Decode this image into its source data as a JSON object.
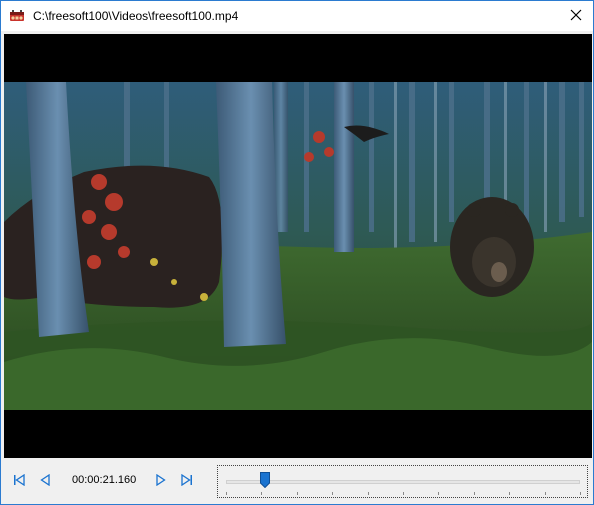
{
  "window": {
    "title": "C:\\freesoft100\\Videos\\freesoft100.mp4",
    "app_icon": "film-projector-icon",
    "close_icon": "close-icon"
  },
  "video": {
    "description_icon": "video-frame-image"
  },
  "controls": {
    "first_icon": "skip-to-start-icon",
    "prev_icon": "step-back-icon",
    "time": "00:00:21.160",
    "next_icon": "step-forward-icon",
    "last_icon": "skip-to-end-icon",
    "seek_position": 0.11
  },
  "colors": {
    "accent": "#2b7bd0",
    "icon_blue": "#1a73d0"
  }
}
